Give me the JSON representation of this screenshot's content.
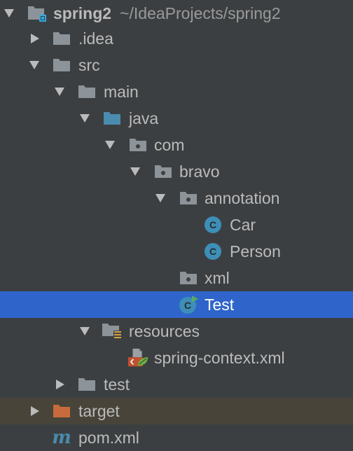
{
  "colors": {
    "background": "#3c3f41",
    "selection": "#2f65ca",
    "excluded_row": "#48443a",
    "folder": "#8c9399",
    "source_folder": "#4a8bb0",
    "excluded_folder": "#c86b3c",
    "class_icon": "#3d8fb7",
    "text": "#bbbbbb",
    "text_selected": "#ffffff"
  },
  "tree": {
    "root": {
      "name": "spring2",
      "path": "~/IdeaProjects/spring2",
      "icon": "module-folder-icon",
      "expanded": true
    },
    "items": [
      {
        "name": ".idea",
        "icon": "folder-icon",
        "expanded": false
      },
      {
        "name": "src",
        "icon": "folder-icon",
        "expanded": true
      },
      {
        "name": "main",
        "icon": "folder-icon",
        "expanded": true
      },
      {
        "name": "java",
        "icon": "source-folder-icon",
        "expanded": true
      },
      {
        "name": "com",
        "icon": "package-icon",
        "expanded": true
      },
      {
        "name": "bravo",
        "icon": "package-icon",
        "expanded": true
      },
      {
        "name": "annotation",
        "icon": "package-icon",
        "expanded": true
      },
      {
        "name": "Car",
        "icon": "class-icon"
      },
      {
        "name": "Person",
        "icon": "class-icon"
      },
      {
        "name": "xml",
        "icon": "package-icon"
      },
      {
        "name": "Test",
        "icon": "runnable-class-icon",
        "selected": true
      },
      {
        "name": "resources",
        "icon": "resources-folder-icon",
        "expanded": true
      },
      {
        "name": "spring-context.xml",
        "icon": "spring-xml-icon"
      },
      {
        "name": "test",
        "icon": "folder-icon",
        "expanded": false
      },
      {
        "name": "target",
        "icon": "excluded-folder-icon",
        "expanded": false
      },
      {
        "name": "pom.xml",
        "icon": "maven-pom-icon"
      }
    ]
  }
}
